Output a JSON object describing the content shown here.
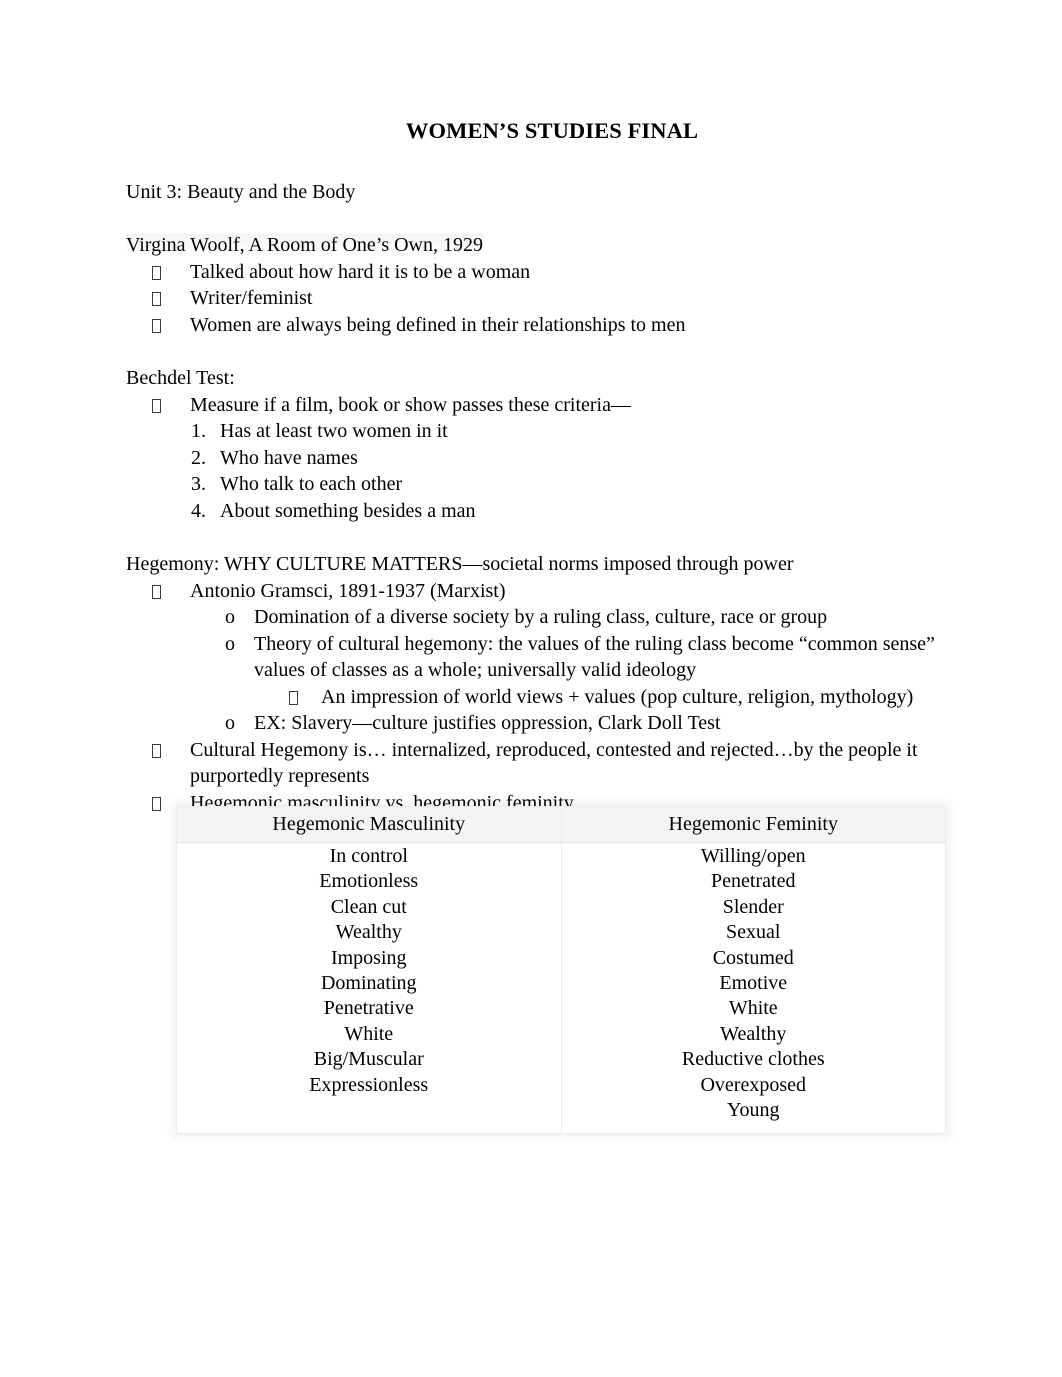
{
  "document": {
    "title": "WOMEN’S STUDIES FINAL",
    "unit_heading": "Unit 3: Beauty and the Body",
    "sections": {
      "woolf": {
        "heading": "Virgina Woolf, A Room of One’s Own, 1929",
        "bullets": [
          "Talked about how hard it is to be a woman",
          "Writer/feminist",
          "Women are always being defined in their relationships to men"
        ]
      },
      "bechdel": {
        "heading": "Bechdel Test:",
        "bullet": "Measure if a film, book or show passes these criteria—",
        "criteria": [
          {
            "number": "1.",
            "text": "Has at least two women in it"
          },
          {
            "number": "2.",
            "text": "Who have names"
          },
          {
            "number": "3.",
            "text": "Who talk to each other"
          },
          {
            "number": "4.",
            "text": "About something besides a man"
          }
        ]
      },
      "hegemony": {
        "heading": "Hegemony: WHY CULTURE MATTERS—societal norms imposed through power",
        "gramsci": "Antonio Gramsci, 1891-1937 (Marxist)",
        "sub_o_1": "Domination of a diverse society by a ruling class, culture, race or group",
        "sub_o_2": "Theory of cultural hegemony: the values of the ruling class become “common sense” values of classes as a whole; universally valid ideology",
        "sub_sub": "An impression of world views + values (pop culture, religion, mythology)",
        "sub_o_3": "EX: Slavery—culture justifies oppression, Clark Doll Test",
        "cultural_hegemony": "Cultural Hegemony is… internalized, reproduced, contested and rejected…by the people it purportedly represents",
        "masc_vs_fem": "Hegemonic masculinity vs. hegemonic feminity"
      }
    },
    "comparison_table": {
      "columns": [
        {
          "header": "Hegemonic Masculinity",
          "items": [
            "In control",
            "Emotionless",
            "Clean cut",
            "Wealthy",
            "Imposing",
            "Dominating",
            "Penetrative",
            "White",
            "Big/Muscular",
            "Expressionless"
          ]
        },
        {
          "header": "Hegemonic Feminity",
          "items": [
            "Willing/open",
            "Penetrated",
            "Slender",
            "Sexual",
            "Costumed",
            "Emotive",
            "White",
            "Wealthy",
            "Reductive clothes",
            "Overexposed",
            "Young"
          ]
        }
      ]
    },
    "markers": {
      "bullet_glyph": "missing-glyph-box",
      "sub_bullet": "o"
    }
  }
}
